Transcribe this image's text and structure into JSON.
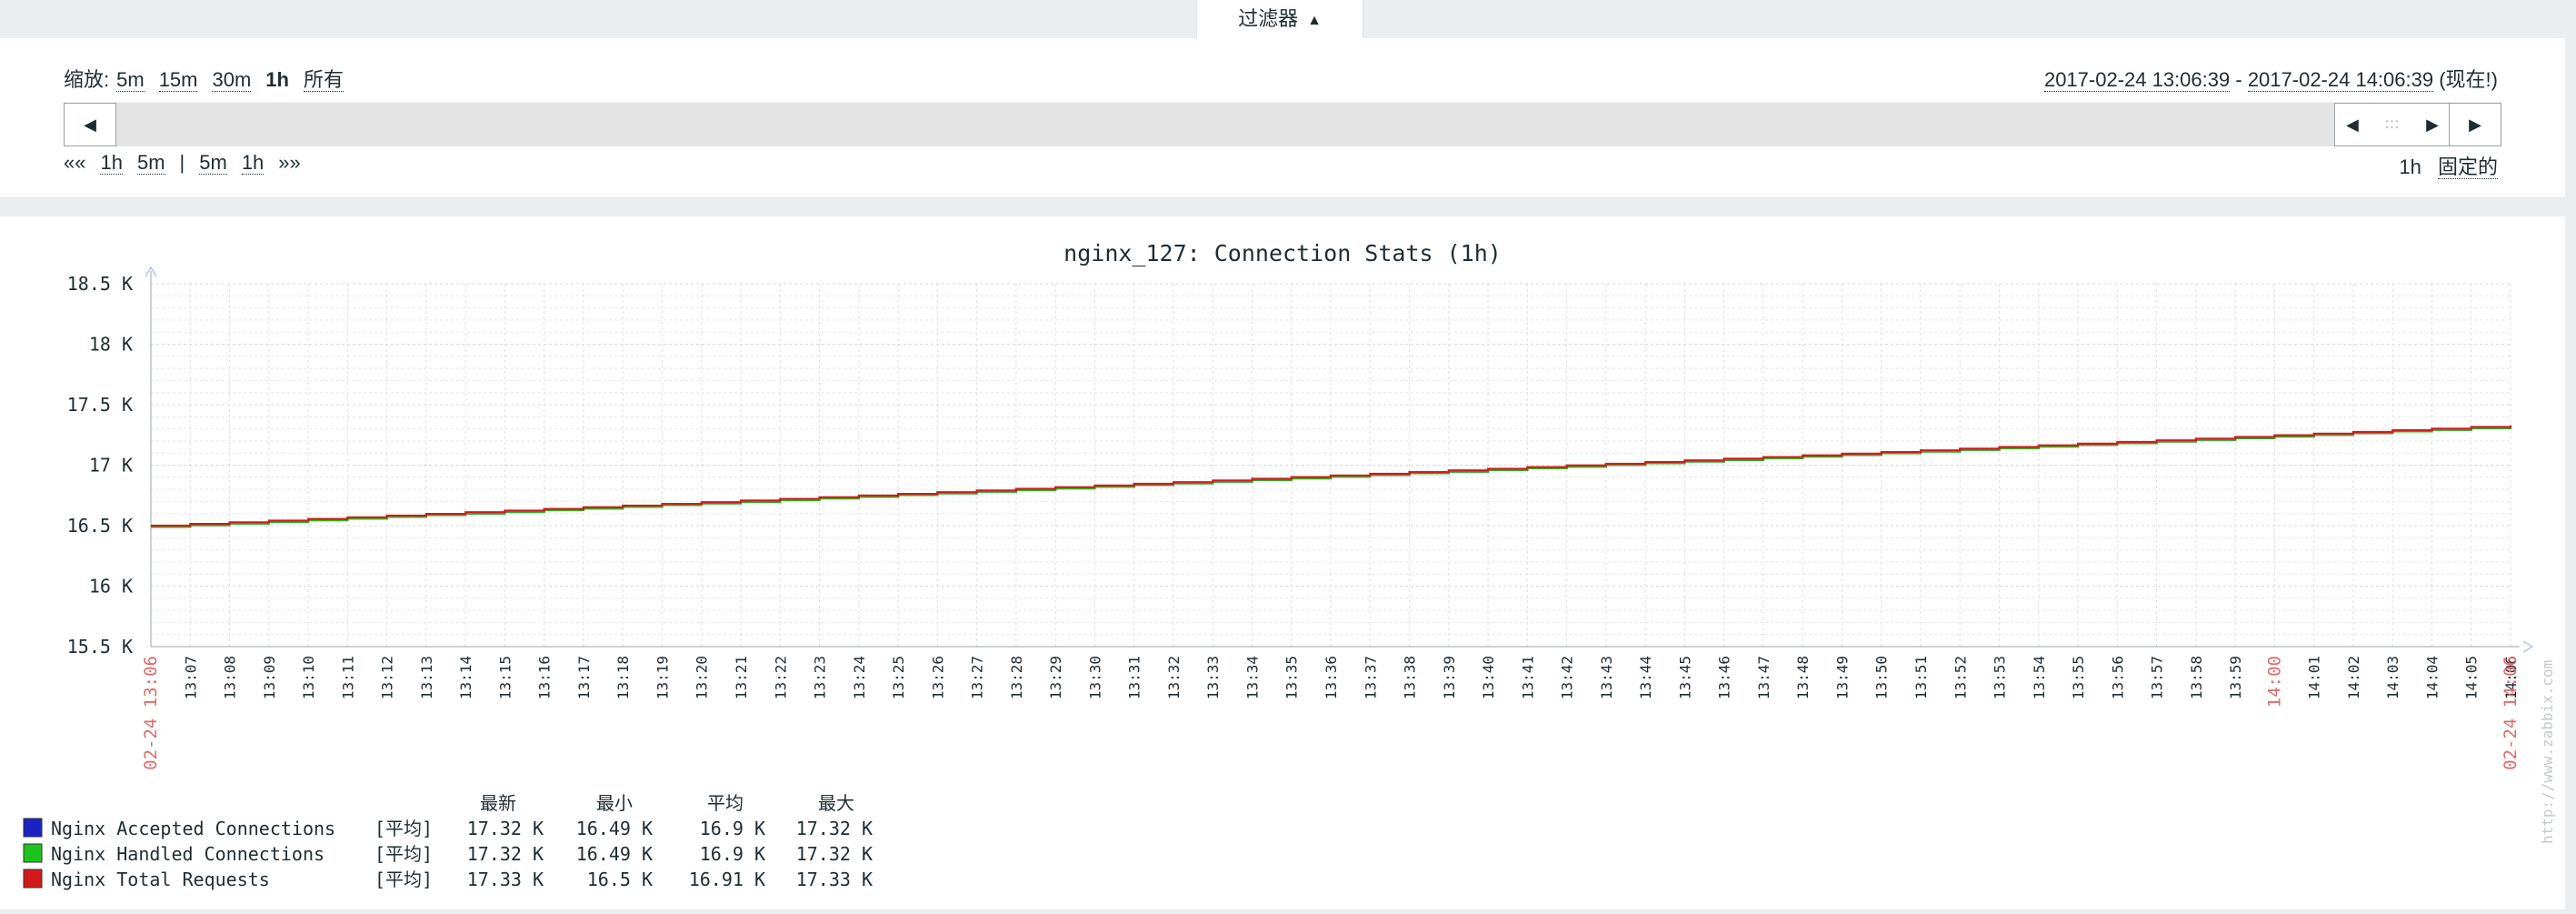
{
  "filter_tab": {
    "label": "过滤器",
    "arrow": "▲"
  },
  "zoom": {
    "label": "缩放:",
    "options": [
      {
        "label": "5m",
        "active": false
      },
      {
        "label": "15m",
        "active": false
      },
      {
        "label": "30m",
        "active": false
      },
      {
        "label": "1h",
        "active": true
      },
      {
        "label": "所有",
        "active": false
      }
    ]
  },
  "time_range": {
    "from": "2017-02-24 13:06:39",
    "separator": " - ",
    "to": "2017-02-24 14:06:39",
    "now_label": "(现在!)"
  },
  "scrollbar": {
    "left_button": "◀",
    "handle_left": "◀",
    "handle_grip": ":::",
    "handle_right": "▶",
    "right_button": "▶"
  },
  "shift": {
    "back_arrows": "««",
    "back_options": [
      "1h",
      "5m"
    ],
    "separator": "|",
    "forward_options": [
      "5m",
      "1h"
    ],
    "forward_arrows": "»»"
  },
  "period": {
    "value": "1h",
    "mode": "固定的"
  },
  "chart_data": {
    "type": "line",
    "title": "nginx_127: Connection Stats (1h)",
    "xlabel": "",
    "ylabel": "",
    "ylim": [
      15500,
      18500
    ],
    "y_ticks": [
      "15.5 K",
      "16 K",
      "16.5 K",
      "17 K",
      "17.5 K",
      "18 K",
      "18.5 K"
    ],
    "y_tick_values": [
      15500,
      16000,
      16500,
      17000,
      17500,
      18000,
      18500
    ],
    "x_start_label": "02-24 13:06",
    "x_end_label": "02-24 14:06",
    "x_ticks": [
      "13:07",
      "13:08",
      "13:09",
      "13:10",
      "13:11",
      "13:12",
      "13:13",
      "13:14",
      "13:15",
      "13:16",
      "13:17",
      "13:18",
      "13:19",
      "13:20",
      "13:21",
      "13:22",
      "13:23",
      "13:24",
      "13:25",
      "13:26",
      "13:27",
      "13:28",
      "13:29",
      "13:30",
      "13:31",
      "13:32",
      "13:33",
      "13:34",
      "13:35",
      "13:36",
      "13:37",
      "13:38",
      "13:39",
      "13:40",
      "13:41",
      "13:42",
      "13:43",
      "13:44",
      "13:45",
      "13:46",
      "13:47",
      "13:48",
      "13:49",
      "13:50",
      "13:51",
      "13:52",
      "13:53",
      "13:54",
      "13:55",
      "13:56",
      "13:57",
      "13:58",
      "13:59",
      "14:00",
      "14:01",
      "14:02",
      "14:03",
      "14:04",
      "14:05",
      "14:06"
    ],
    "x_highlight": [
      "14:00"
    ],
    "grid": true,
    "watermark": "http://www.zabbix.com",
    "legend_headers": [
      "最新",
      "最小",
      "平均",
      "最大"
    ],
    "series": [
      {
        "name": "Nginx Accepted Connections",
        "func": "[平均]",
        "color": "#1a22c4",
        "stats": [
          "17.32 K",
          "16.49 K",
          "16.9 K",
          "17.32 K"
        ],
        "start": 16490,
        "end": 17320
      },
      {
        "name": "Nginx Handled Connections",
        "func": "[平均]",
        "color": "#1dc41d",
        "stats": [
          "17.32 K",
          "16.49 K",
          "16.9 K",
          "17.32 K"
        ],
        "start": 16490,
        "end": 17320
      },
      {
        "name": "Nginx Total Requests",
        "func": "[平均]",
        "color": "#d21a1a",
        "stats": [
          "17.33 K",
          "16.5 K",
          "16.91 K",
          "17.33 K"
        ],
        "start": 16500,
        "end": 17330
      }
    ]
  }
}
